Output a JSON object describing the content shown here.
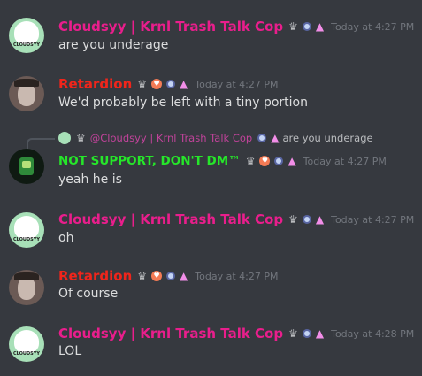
{
  "users": {
    "cloud": {
      "name": "Cloudsyy | Krnl Trash Talk Cop",
      "avatar_label": "CLOUDSYY"
    },
    "retard": {
      "name": "Retardion"
    },
    "ns": {
      "name": "NOT SUPPORT, DON'T DM™"
    }
  },
  "reply": {
    "name": "@Cloudsyy | Krnl Trash Talk Cop",
    "text": "are you underage"
  },
  "messages": [
    {
      "author": "cloud",
      "time": "Today at 4:27 PM",
      "text": "are you underage"
    },
    {
      "author": "retard",
      "time": "Today at 4:27 PM",
      "text": "We'd probably be left with a tiny portion"
    },
    {
      "author": "ns",
      "time": "Today at 4:27 PM",
      "text": "yeah he is"
    },
    {
      "author": "cloud",
      "time": "Today at 4:27 PM",
      "text": "oh"
    },
    {
      "author": "retard",
      "time": "Today at 4:27 PM",
      "text": "Of course"
    },
    {
      "author": "cloud",
      "time": "Today at 4:28 PM",
      "text": "LOL"
    }
  ],
  "colors": {
    "background": "#36393f",
    "cloud_name": "#e91e8c",
    "retard_name": "#f0251b",
    "ns_name": "#26e62a",
    "timestamp": "#72767d",
    "text": "#dcddde"
  },
  "icons": [
    "crown-icon",
    "nitro-orb-icon",
    "booster-triangle-icon",
    "heart-badge-icon",
    "reply-line-icon"
  ]
}
